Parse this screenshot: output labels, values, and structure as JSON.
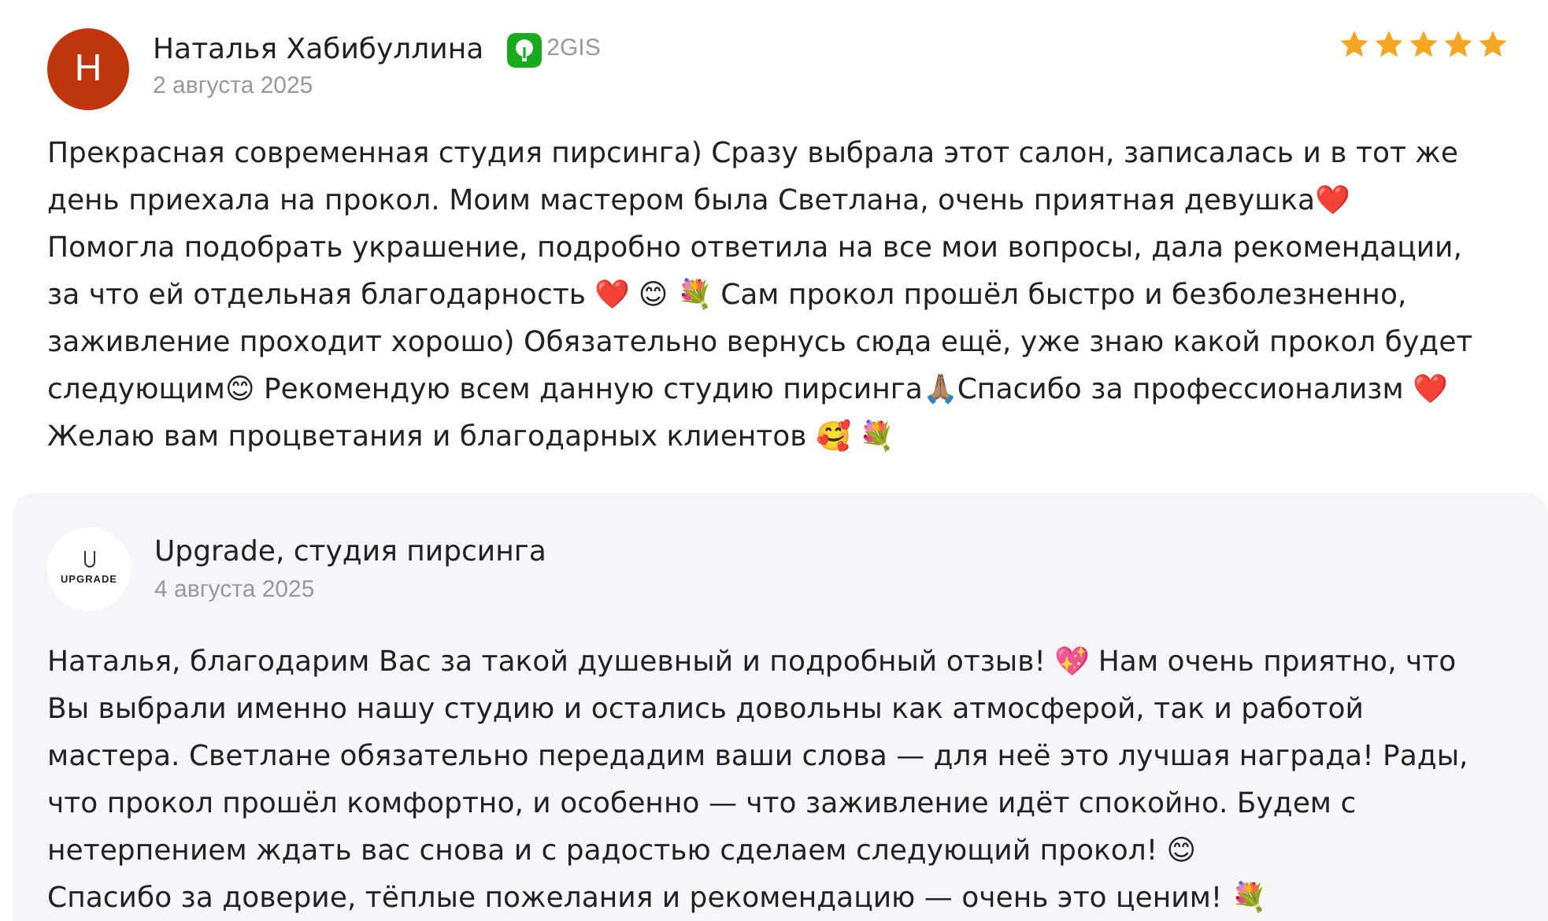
{
  "review": {
    "avatar_letter": "Н",
    "author": "Наталья Хабибуллина",
    "source": "2GIS",
    "date": "2 августа 2025",
    "stars": 5,
    "text": "Прекрасная современная студия пирсинга) Сразу выбрала этот салон, записалась и в тот же день приехала на прокол. Моим мастером была Светлана, очень приятная девушка❤️ Помогла подобрать украшение, подробно ответила на все мои вопросы, дала рекомендации, за что ей отдельная благодарность ❤️ 😊 💐 Сам прокол прошёл быстро и безболезненно, заживление проходит хорошо) Обязательно вернусь сюда ещё, уже знаю какой прокол будет следующим😊 Рекомендую всем данную студию пирсинга🙏🏽Спасибо за профессионализм ❤️ Желаю вам процветания и благодарных клиентов 🥰 💐"
  },
  "reply": {
    "logo_text": "UPGRADE",
    "author": "Upgrade, студия пирсинга",
    "date": "4 августа 2025",
    "text": "Наталья, благодарим Вас за такой душевный и подробный отзыв! 💖 Нам очень приятно, что Вы выбрали именно нашу студию и остались довольны как атмосферой, так и работой мастера. Светлане обязательно передадим ваши слова — для неё это лучшая награда! Рады, что прокол прошёл комфортно, и особенно — что заживление идёт спокойно. Будем с нетерпением ждать вас снова и с радостью сделаем следующий прокол! 😊\nСпасибо за доверие, тёплые пожелания и рекомендацию — очень это ценим! 💐"
  }
}
